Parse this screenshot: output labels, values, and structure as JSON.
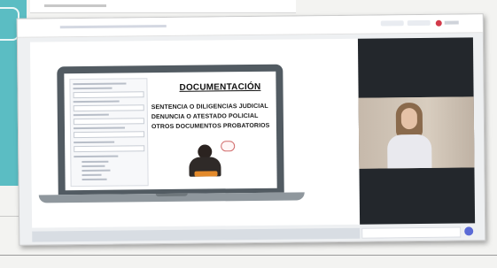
{
  "slide": {
    "title": "DOCUMENTACIÓN",
    "items": [
      "SENTENCIA O DILIGENCIAS JUDICIAL",
      "DENUNCIA O ATESTADO POLICIAL",
      "OTROS DOCUMENTOS PROBATORIOS"
    ]
  },
  "icons": {
    "record": "record-dot-icon",
    "send": "send-icon"
  },
  "colors": {
    "teal": "#5bbdc3",
    "record": "#d23a4a",
    "laptop": "#525b62",
    "video_bg": "#23272c"
  }
}
